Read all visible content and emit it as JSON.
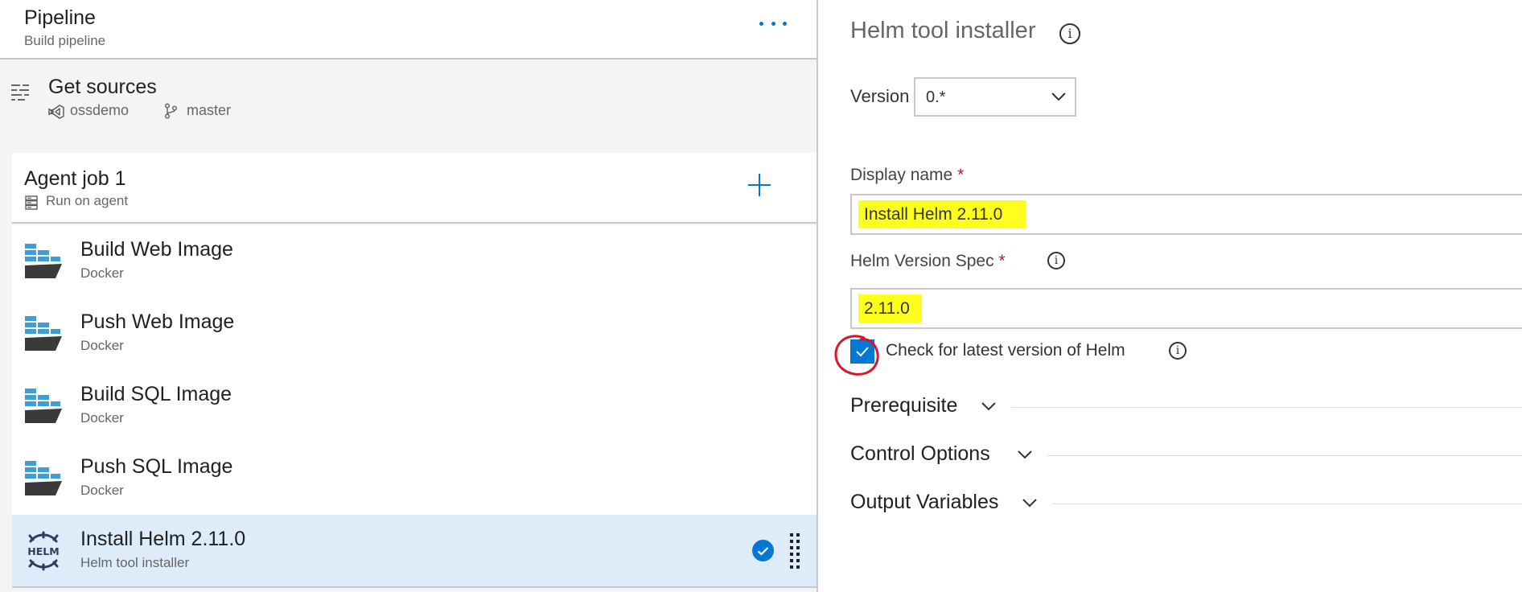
{
  "pipeline": {
    "title": "Pipeline",
    "subtitle": "Build pipeline",
    "more_icon": "ellipsis-icon"
  },
  "sources": {
    "title": "Get sources",
    "repo": "ossdemo",
    "branch": "master"
  },
  "job": {
    "title": "Agent job 1",
    "subtitle": "Run on agent"
  },
  "tasks": [
    {
      "name": "Build Web Image",
      "type": "Docker",
      "icon": "docker-icon"
    },
    {
      "name": "Push Web Image",
      "type": "Docker",
      "icon": "docker-icon"
    },
    {
      "name": "Build SQL Image",
      "type": "Docker",
      "icon": "docker-icon"
    },
    {
      "name": "Push SQL Image",
      "type": "Docker",
      "icon": "docker-icon"
    },
    {
      "name": "Install Helm 2.11.0",
      "type": "Helm tool installer",
      "icon": "helm-icon",
      "icon_text": "HELM",
      "selected": true
    }
  ],
  "details": {
    "title": "Helm tool installer",
    "version_label": "Version",
    "version_value": "0.*",
    "display_name_label": "Display name",
    "display_name_value": "Install Helm 2.11.0",
    "helm_spec_label": "Helm Version Spec",
    "helm_spec_value": "2.11.0",
    "required_mark": "*",
    "checkbox_label": "Check for latest version of Helm",
    "checkbox_checked": true,
    "info_glyph": "i",
    "sections": [
      "Prerequisite",
      "Control Options",
      "Output Variables"
    ]
  },
  "colors": {
    "accent": "#0078d4",
    "selected_row": "#deecf9",
    "highlight": "#ffff1e",
    "annotation_red": "#d6172b",
    "docker_blue": "#3d9fd6",
    "docker_dark": "#3a3a3a",
    "helm_navy": "#2b3e5f"
  }
}
